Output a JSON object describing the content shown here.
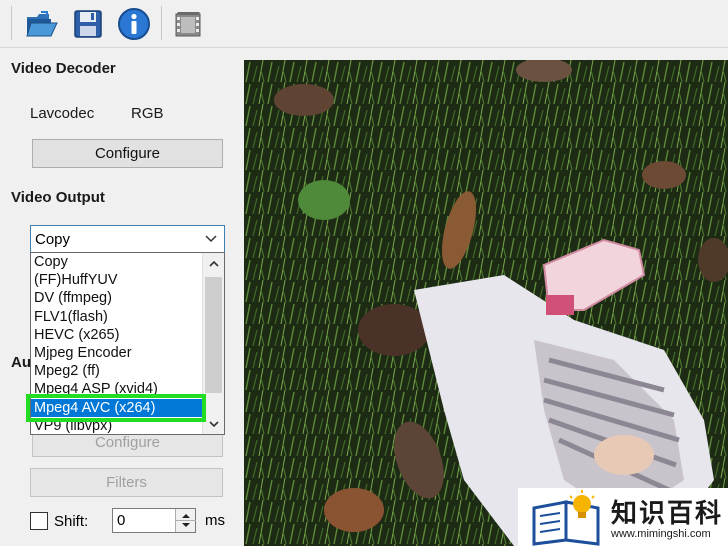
{
  "toolbar": {
    "buttons": [
      {
        "icon": "open-folder-icon"
      },
      {
        "icon": "save-icon"
      },
      {
        "icon": "info-icon"
      },
      {
        "icon": "film-icon"
      }
    ]
  },
  "video_decoder": {
    "title": "Video Decoder",
    "codec": "Lavcodec",
    "colorspace": "RGB",
    "configure_label": "Configure"
  },
  "video_output": {
    "title": "Video Output",
    "selected": "Copy",
    "options": [
      "Copy",
      "(FF)HuffYUV",
      "DV (ffmpeg)",
      "FLV1(flash)",
      "HEVC (x265)",
      "Mjpeg Encoder",
      "Mpeg2 (ff)",
      "Mpeg4 ASP (xvid4)",
      "Mpeg4 AVC (x264)",
      "VP9 (libvpx)"
    ],
    "highlighted_index": 8
  },
  "audio_output": {
    "title_partial": "Au",
    "configure_label": "Configure",
    "filters_label": "Filters",
    "shift_label": "Shift:",
    "shift_value": "0",
    "shift_unit": "ms"
  },
  "watermark": {
    "text": "知识百科",
    "url": "www.mimingshi.com"
  },
  "colors": {
    "accent": "#0078d7",
    "highlight_box": "#22dd22"
  }
}
